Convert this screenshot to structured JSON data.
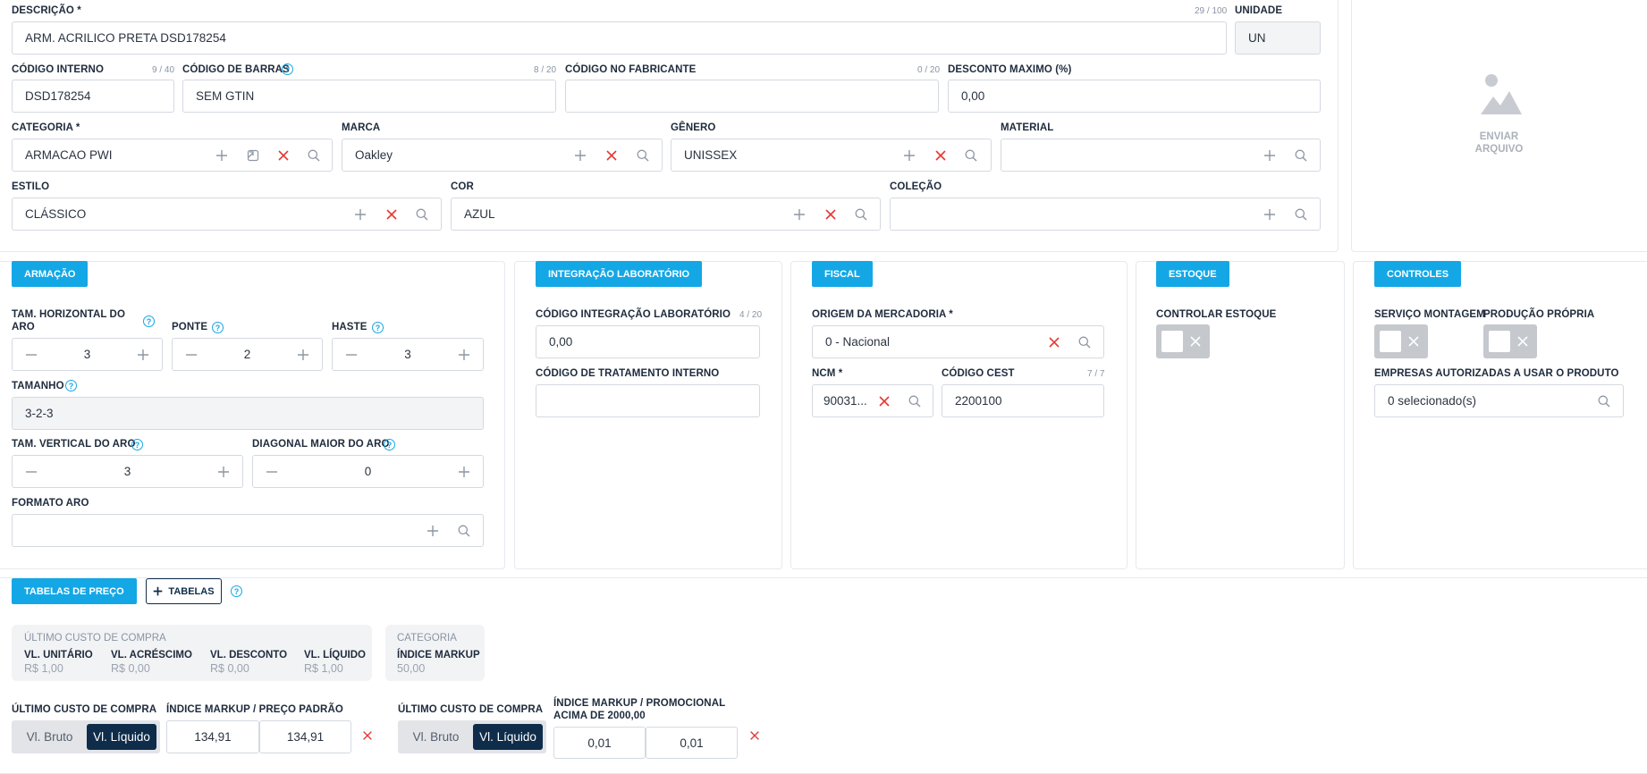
{
  "product": {
    "descricao": {
      "label": "DESCRIÇÃO *",
      "count": "29 / 100",
      "value": "ARM. ACRILICO PRETA DSD178254"
    },
    "unidade": {
      "label": "UNIDADE",
      "value": "UN"
    },
    "codigo_interno": {
      "label": "CÓDIGO INTERNO",
      "count": "9 / 40",
      "value": "DSD178254"
    },
    "codigo_barras": {
      "label": "CÓDIGO DE BARRAS",
      "count": "8 / 20",
      "value": "SEM GTIN"
    },
    "codigo_fabricante": {
      "label": "CÓDIGO NO FABRICANTE",
      "count": "0 / 20",
      "value": ""
    },
    "desconto_maximo": {
      "label": "DESCONTO MAXIMO (%)",
      "value": "0,00"
    },
    "categoria": {
      "label": "CATEGORIA *",
      "value": "ARMACAO PWI"
    },
    "marca": {
      "label": "MARCA",
      "value": "Oakley"
    },
    "genero": {
      "label": "GÊNERO",
      "value": "UNISSEX"
    },
    "material": {
      "label": "MATERIAL",
      "value": ""
    },
    "estilo": {
      "label": "ESTILO",
      "value": "CLÁSSICO"
    },
    "cor": {
      "label": "COR",
      "value": "AZUL"
    },
    "colecao": {
      "label": "COLEÇÃO",
      "value": ""
    },
    "upload": {
      "line1": "ENVIAR",
      "line2": "ARQUIVO"
    }
  },
  "armacao": {
    "tab": "ARMAÇÃO",
    "tam_horizontal": {
      "label1": "TAM. HORIZONTAL DO",
      "label2": "ARO",
      "value": "3"
    },
    "ponte": {
      "label": "PONTE",
      "value": "2"
    },
    "haste": {
      "label": "HASTE",
      "value": "3"
    },
    "tamanho": {
      "label": "TAMANHO",
      "value": "3-2-3"
    },
    "tam_vertical": {
      "label": "TAM. VERTICAL DO ARO",
      "value": "3"
    },
    "diagonal": {
      "label": "DIAGONAL MAIOR DO ARO",
      "value": "0"
    },
    "formato": {
      "label": "FORMATO ARO",
      "value": ""
    }
  },
  "integracao": {
    "tab": "INTEGRAÇÃO LABORATÓRIO",
    "codigo_integracao": {
      "label": "CÓDIGO INTEGRAÇÃO LABORATÓRIO",
      "count": "4 / 20",
      "value": "0,00"
    },
    "codigo_tratamento": {
      "label": "CÓDIGO DE TRATAMENTO INTERNO",
      "value": ""
    }
  },
  "fiscal": {
    "tab": "FISCAL",
    "origem": {
      "label": "ORIGEM DA MERCADORIA *",
      "value": "0 - Nacional"
    },
    "ncm": {
      "label": "NCM *",
      "value": "90031..."
    },
    "cest": {
      "label": "CÓDIGO CEST",
      "count": "7 / 7",
      "value": "2200100"
    }
  },
  "estoque": {
    "tab": "ESTOQUE",
    "controlar": "CONTROLAR ESTOQUE"
  },
  "controles": {
    "tab": "CONTROLES",
    "servico": "SERVIÇO MONTAGEM",
    "producao": "PRODUÇÃO PRÓPRIA",
    "empresas": {
      "label": "EMPRESAS AUTORIZADAS A USAR O PRODUTO",
      "value": "0 selecionado(s)"
    }
  },
  "precos": {
    "tab": "TABELAS DE PREÇO",
    "add_button": "TABELAS",
    "custo_box": {
      "title": "ÚLTIMO CUSTO DE COMPRA",
      "cols": [
        {
          "h": "VL. UNITÁRIO",
          "v": "R$ 1,00"
        },
        {
          "h": "VL. ACRÉSCIMO",
          "v": "R$ 0,00"
        },
        {
          "h": "VL. DESCONTO",
          "v": "R$ 0,00"
        },
        {
          "h": "VL. LÍQUIDO",
          "v": "R$ 1,00"
        }
      ]
    },
    "categoria_box": {
      "title": "CATEGORIA",
      "h": "ÍNDICE MARKUP",
      "v": "50,00"
    },
    "padrao": {
      "custo_label": "ÚLTIMO CUSTO DE COMPRA",
      "bruto": "Vl. Bruto",
      "liquido": "Vl. Líquido",
      "markup_label": "ÍNDICE MARKUP / PREÇO PADRÃO",
      "markup": "134,91",
      "preco": "134,91"
    },
    "promo": {
      "custo_label": "ÚLTIMO CUSTO DE COMPRA",
      "bruto": "Vl. Bruto",
      "liquido": "Vl. Líquido",
      "markup_label1": "ÍNDICE MARKUP / PROMOCIONAL",
      "markup_label2": "ACIMA DE 2000,00",
      "markup": "0,01",
      "preco": "0,01"
    }
  },
  "colors": {
    "accent": "#14a7e6",
    "danger": "#e53935",
    "dark": "#0f2d4a"
  }
}
